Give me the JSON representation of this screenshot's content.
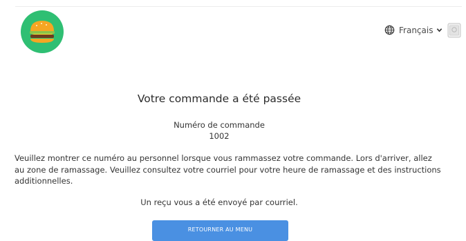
{
  "header": {
    "logo_icon": "hamburger-icon",
    "language": {
      "icon": "globe-icon",
      "label": "Français",
      "chevron_icon": "chevron-down-icon"
    },
    "cart_icon": "cart-icon"
  },
  "confirmation": {
    "title": "Votre commande a été passée",
    "order_number_label": "Numéro de commande",
    "order_number": "1002",
    "instructions": "Veuillez montrer ce numéro au personnel lorsque vous rammassez votre commande. Lors d'arriver, allez au zone de ramassage. Veuillez consultez votre courriel pour votre heure de ramassage et des instructions additionnelles.",
    "receipt_notice": "Un reçu vous a été envoyé par courriel.",
    "back_button_label": "RETOURNER AU MENU"
  },
  "colors": {
    "logo_background": "#2fbf73",
    "button": "#4a90e2"
  }
}
